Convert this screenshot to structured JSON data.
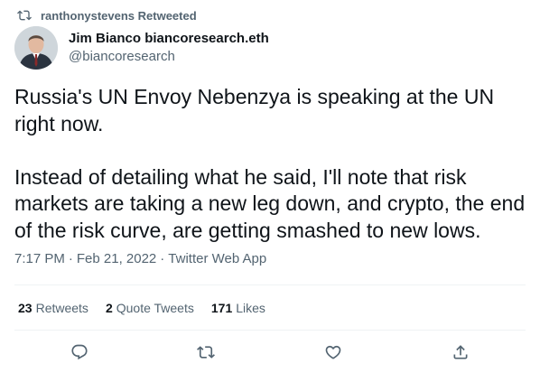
{
  "retweet_context": {
    "text": "ranthonystevens Retweeted",
    "icon": "retweet-icon"
  },
  "author": {
    "display_name": "Jim Bianco biancoresearch.eth",
    "handle": "@biancoresearch",
    "avatar": "avatar-photo"
  },
  "tweet": {
    "paragraph_1": "Russia's UN Envoy Nebenzya is speaking at the UN right now.",
    "paragraph_2": "Instead of detailing what he said, I'll note that risk markets are taking a new leg down, and crypto, the end of the risk curve, are getting smashed to new lows."
  },
  "meta": {
    "time": "7:17 PM",
    "separator_1": "·",
    "date": "Feb 21, 2022",
    "separator_2": "·",
    "source": "Twitter Web App"
  },
  "stats": {
    "retweets_count": "23",
    "retweets_label": "Retweets",
    "quote_tweets_count": "2",
    "quote_tweets_label": "Quote Tweets",
    "likes_count": "171",
    "likes_label": "Likes"
  },
  "actions": [
    {
      "name": "reply",
      "icon": "reply-icon"
    },
    {
      "name": "retweet",
      "icon": "retweet-icon"
    },
    {
      "name": "like",
      "icon": "heart-icon"
    },
    {
      "name": "share",
      "icon": "share-icon"
    }
  ],
  "colors": {
    "primary_text": "#0f1419",
    "secondary_text": "#536471",
    "divider": "#eff3f4"
  }
}
